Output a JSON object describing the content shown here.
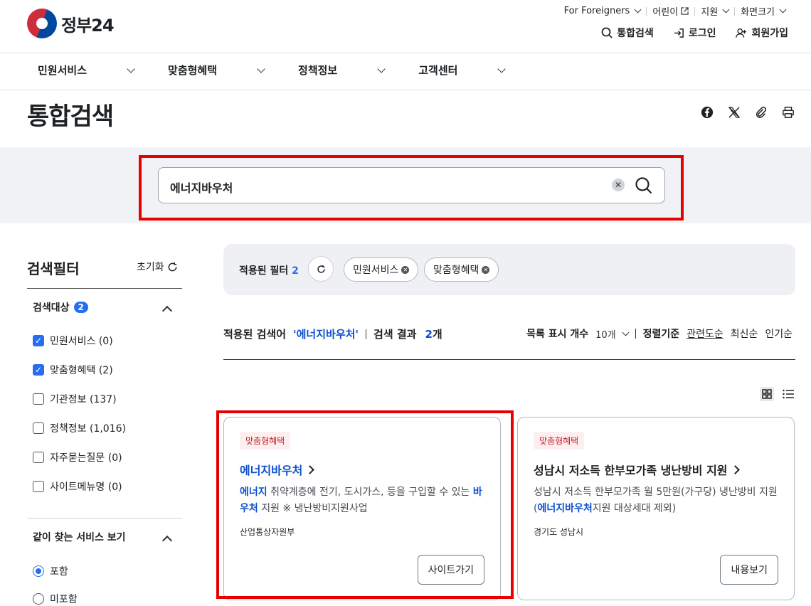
{
  "header": {
    "logo_text": "정부24",
    "util_links": [
      "For Foreigners",
      "어린이",
      "지원",
      "화면크기"
    ],
    "top_links": [
      "통합검색",
      "로그인",
      "회원가입"
    ],
    "gnb": [
      "민원서비스",
      "맞춤형혜택",
      "정책정보",
      "고객센터"
    ]
  },
  "page_title": "통합검색",
  "search": {
    "value": "에너지바우처"
  },
  "filter": {
    "title": "검색필터",
    "reset": "초기화",
    "section1": {
      "label": "검색대상",
      "count": "2"
    },
    "checkboxes": [
      {
        "label": "민원서비스 (0)",
        "checked": true
      },
      {
        "label": "맞춤형혜택 (2)",
        "checked": true
      },
      {
        "label": "기관정보 (137)",
        "checked": false
      },
      {
        "label": "정책정보 (1,016)",
        "checked": false
      },
      {
        "label": "자주묻는질문 (0)",
        "checked": false
      },
      {
        "label": "사이트메뉴명 (0)",
        "checked": false
      }
    ],
    "section2": {
      "label": "같이 찾는 서비스 보기"
    },
    "radios": [
      {
        "label": "포함",
        "checked": true
      },
      {
        "label": "미포함",
        "checked": false
      }
    ]
  },
  "applied": {
    "label": "적용된 필터",
    "count": "2",
    "chips": [
      "민원서비스",
      "맞춤형혜택"
    ]
  },
  "result_summary": {
    "label": "적용된 검색어",
    "keyword": "'에너지바우처'",
    "result_label": "검색 결과",
    "count": "2",
    "count_unit": "개"
  },
  "result_options": {
    "page_size_label": "목록 표시 개수",
    "page_size": "10개",
    "sort_label": "정렬기준",
    "sorts": [
      "관련도순",
      "최신순",
      "인기순"
    ]
  },
  "cards": [
    {
      "tag": "맞춤형혜택",
      "title": "에너지바우처",
      "desc_hl1": "에너지",
      "desc_1": " 취약계층에 전기, 도시가스, 등을 구입할 수 있는 ",
      "desc_hl2": "바우처",
      "desc_2": " 지원 ※ 냉난방비지원사업",
      "org": "산업통상자원부",
      "button": "사이트가기"
    },
    {
      "tag": "맞춤형혜택",
      "title": "성남시 저소득 한부모가족 냉난방비 지원",
      "desc_1": "성남시 저소득 한부모가족 월 5만원(가구당) 냉난방비 지원(",
      "desc_hl1": "에너지바우처",
      "desc_2": "지원 대상세대 제외)",
      "org": "경기도 성남시",
      "button": "내용보기"
    }
  ]
}
